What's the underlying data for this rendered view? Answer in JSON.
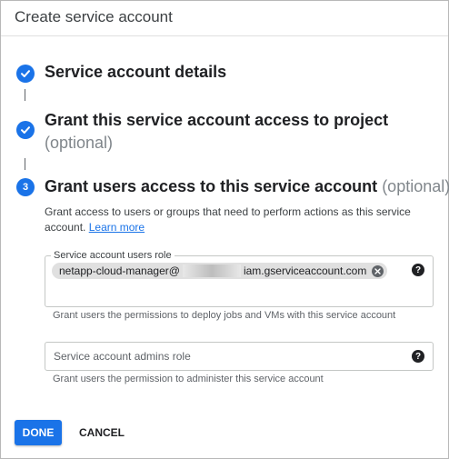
{
  "dialog": {
    "title": "Create service account"
  },
  "steps": [
    {
      "label": "Service account details",
      "optional": "",
      "status": "completed",
      "icon": "check-icon"
    },
    {
      "label": "Grant this service account access to project",
      "optional": "(optional)",
      "status": "completed",
      "icon": "check-icon"
    },
    {
      "label": "Grant users access to this service account",
      "optional": "(optional)",
      "status": "active",
      "number": "3"
    }
  ],
  "step3": {
    "description": "Grant access to users or groups that need to perform actions as this service account.",
    "learn_more": "Learn more",
    "users_role": {
      "label": "Service account users role",
      "chip_prefix": "netapp-cloud-manager@",
      "chip_suffix": "iam.gserviceaccount.com",
      "help": "?",
      "hint": "Grant users the permissions to deploy jobs and VMs with this service account"
    },
    "admins_role": {
      "placeholder": "Service account admins role",
      "help": "?",
      "hint": "Grant users the permission to administer this service account"
    }
  },
  "actions": {
    "done": "DONE",
    "cancel": "CANCEL"
  },
  "colors": {
    "accent": "#1a73e8",
    "text": "#202124",
    "muted": "#80868b"
  }
}
